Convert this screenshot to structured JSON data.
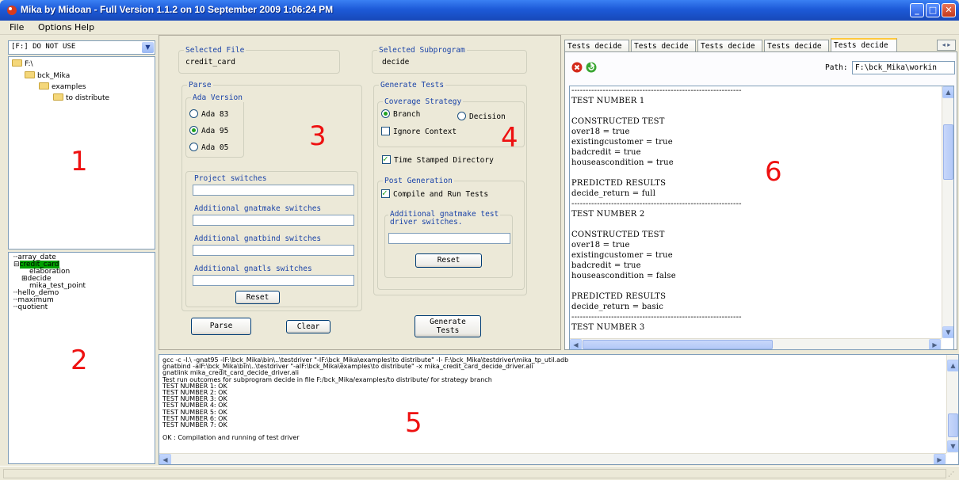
{
  "window": {
    "title": "Mika by Midoan - Full Version 1.1.2 on 10 September 2009 1:06:24 PM"
  },
  "menu": [
    "File",
    "Options",
    "Help"
  ],
  "drive_select": {
    "value": "[F:] DO NOT USE"
  },
  "folder_tree": [
    {
      "label": "F:\\",
      "level": 0
    },
    {
      "label": "bck_Mika",
      "level": 1
    },
    {
      "label": "examples",
      "level": 2
    },
    {
      "label": "to distribute",
      "level": 3
    }
  ],
  "file_tree": [
    {
      "label": "array_date",
      "level": 0,
      "expander": ""
    },
    {
      "label": "credit_card",
      "level": 0,
      "expander": "⊟",
      "selected": true
    },
    {
      "label": "elaboration",
      "level": 1,
      "expander": ""
    },
    {
      "label": "decide",
      "level": 1,
      "expander": "⊞"
    },
    {
      "label": "mika_test_point",
      "level": 1,
      "expander": ""
    },
    {
      "label": "hello_demo",
      "level": 0,
      "expander": ""
    },
    {
      "label": "maximum",
      "level": 0,
      "expander": ""
    },
    {
      "label": "quotient",
      "level": 0,
      "expander": ""
    }
  ],
  "annotations": [
    "1",
    "2",
    "3",
    "4",
    "5",
    "6"
  ],
  "selected_file": {
    "label": "Selected File",
    "value": "credit_card"
  },
  "selected_subprogram": {
    "label": "Selected Subprogram",
    "value": "decide"
  },
  "parse": {
    "label": "Parse",
    "ada_version_label": "Ada Version",
    "ada_versions": [
      "Ada 83",
      "Ada 95",
      "Ada 05"
    ],
    "ada_selected": "Ada 95",
    "project_switches_label": "Project switches",
    "gnatmake_label": "Additional gnatmake switches",
    "gnatbind_label": "Additional gnatbind switches",
    "gnatls_label": "Additional gnatls switches",
    "reset_label": "Reset",
    "parse_button": "Parse",
    "clear_button": "Clear"
  },
  "generate": {
    "label": "Generate Tests",
    "coverage_label": "Coverage Strategy",
    "branch_label": "Branch",
    "decision_label": "Decision",
    "ignore_context_label": "Ignore Context",
    "time_stamped_label": "Time Stamped Directory",
    "post_generation_label": "Post Generation",
    "compile_run_label": "Compile and Run Tests",
    "driver_switches_label_line1": "Additional gnatmake test",
    "driver_switches_label_line2": "driver switches.",
    "reset_label": "Reset",
    "generate_button_line1": "Generate",
    "generate_button_line2": "Tests"
  },
  "tabs": [
    "Tests decide",
    "Tests decide",
    "Tests decide",
    "Tests decide",
    "Tests decide"
  ],
  "tab_nav": "◂ ▸",
  "path": {
    "label": "Path:",
    "value": "F:\\bck_Mika\\workin"
  },
  "results_text": "------------------------------------------------------------\nTEST NUMBER 1\n\nCONSTRUCTED TEST\nover18 = true\nexistingcustomer = true\nbadcredit = true\nhouseascondition = true\n\nPREDICTED RESULTS\ndecide_return = full\n------------------------------------------------------------\nTEST NUMBER 2\n\nCONSTRUCTED TEST\nover18 = true\nexistingcustomer = true\nbadcredit = true\nhouseascondition = false\n\nPREDICTED RESULTS\ndecide_return = basic\n------------------------------------------------------------\nTEST NUMBER 3",
  "console_text": "gcc -c -I.\\ -gnat95 -IF:\\bck_Mika\\bin\\..\\testdriver \"-IF:\\bck_Mika\\examples\\to distribute\" -I- F:\\bck_Mika\\testdriver\\mika_tp_util.adb\ngnatbind -aIF:\\bck_Mika\\bin\\..\\testdriver \"-aIF:\\bck_Mika\\examples\\to distribute\" -x mika_credit_card_decide_driver.ali\ngnatlink mika_credit_card_decide_driver.ali\nTest run outcomes for subprogram decide in file F:/bck_Mika/examples/to distribute/ for strategy branch\nTEST NUMBER 1: OK\nTEST NUMBER 2: OK\nTEST NUMBER 3: OK\nTEST NUMBER 4: OK\nTEST NUMBER 5: OK\nTEST NUMBER 6: OK\nTEST NUMBER 7: OK\n\nOK : Compilation and running of test driver",
  "colors": {
    "titlebar": "#1d5ad8",
    "annotation": "#ee1111",
    "group_label": "#1a43a8",
    "selection": "#00a000",
    "tab_highlight": "#ffc83c"
  }
}
